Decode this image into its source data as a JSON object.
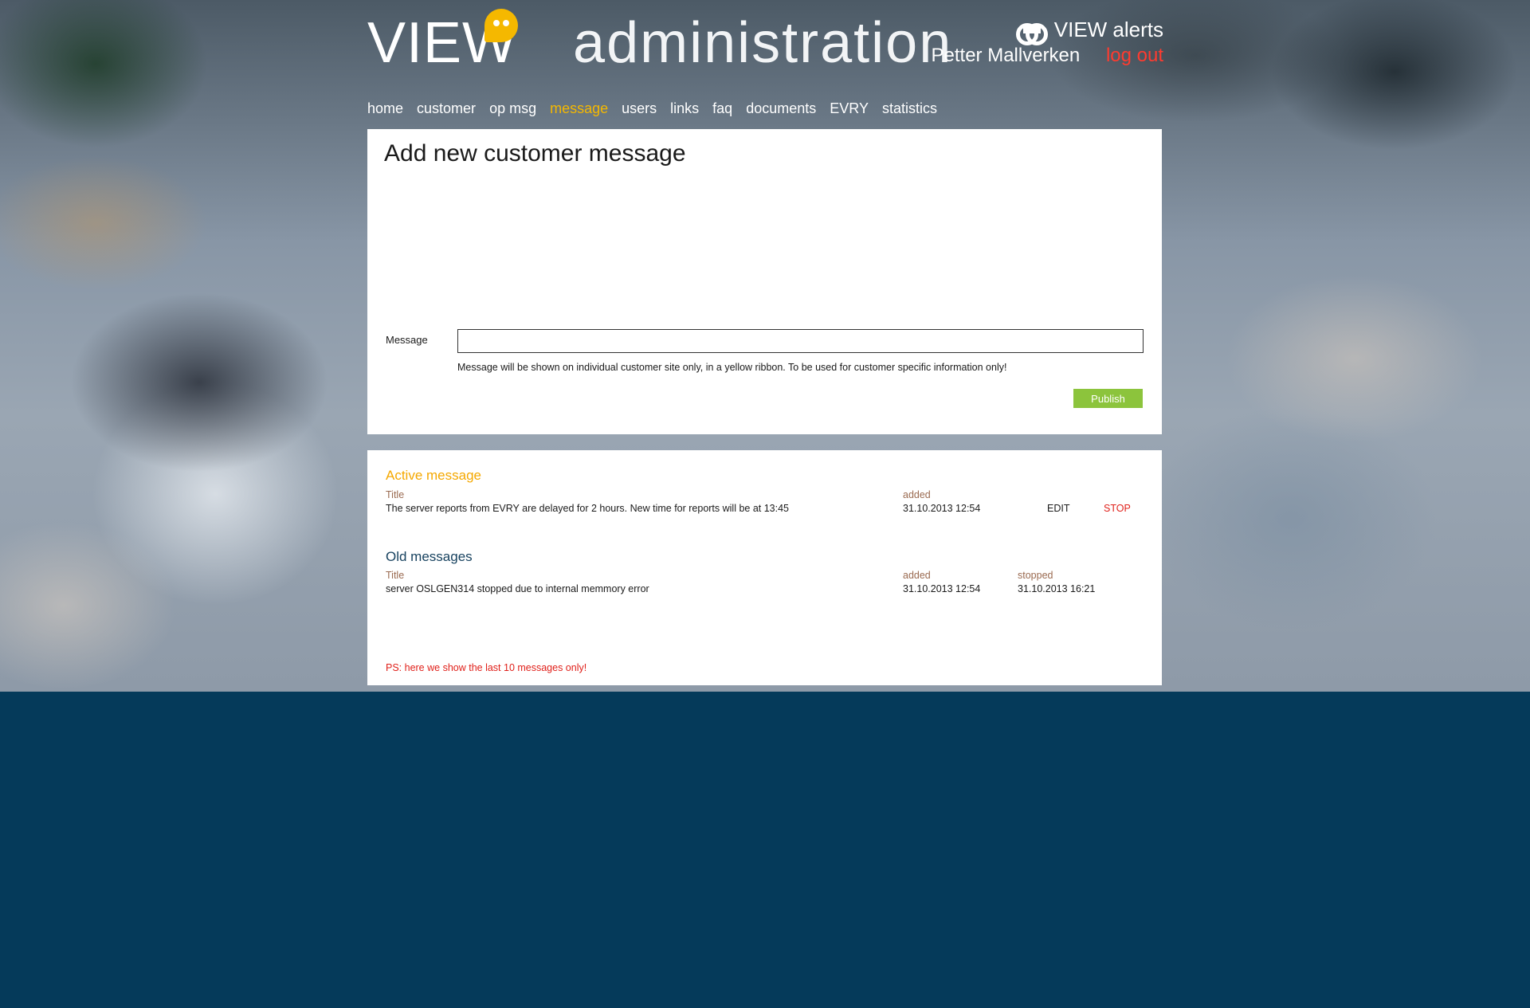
{
  "header": {
    "logo_view": "VIEW",
    "logo_admin": "administration",
    "alerts_label": "VIEW alerts",
    "user_name": "Petter Mallverken",
    "logout_label": "log out"
  },
  "nav": {
    "items": [
      "home",
      "customer",
      "op msg",
      "message",
      "users",
      "links",
      "faq",
      "documents",
      "EVRY",
      "statistics"
    ],
    "active": "message"
  },
  "form": {
    "title": "Add new customer message",
    "message_label": "Message",
    "message_value": "",
    "help_text": "Message will be shown on individual customer site only, in a yellow ribbon. To be used for customer specific information only!",
    "publish_label": "Publish"
  },
  "active_message": {
    "section_title": "Active message",
    "col_title": "Title",
    "col_added": "added",
    "title": "The server reports from EVRY are delayed for 2 hours. New time for reports will be at 13:45",
    "added": "31.10.2013  12:54",
    "edit_label": "EDIT",
    "stop_label": "STOP"
  },
  "old_messages": {
    "section_title": "Old messages",
    "col_title": "Title",
    "col_added": "added",
    "col_stopped": "stopped",
    "rows": [
      {
        "title": "server OSLGEN314  stopped due to internal memmory error",
        "added": "31.10.2013  12:54",
        "stopped": "31.10.2013 16:21"
      }
    ]
  },
  "footer_note": "PS: here we show the last 10 messages only!",
  "colors": {
    "accent_yellow": "#f5b800",
    "logout_red": "#ff3b2f",
    "publish_green": "#8cc43c",
    "page_navy": "#053a5a"
  }
}
